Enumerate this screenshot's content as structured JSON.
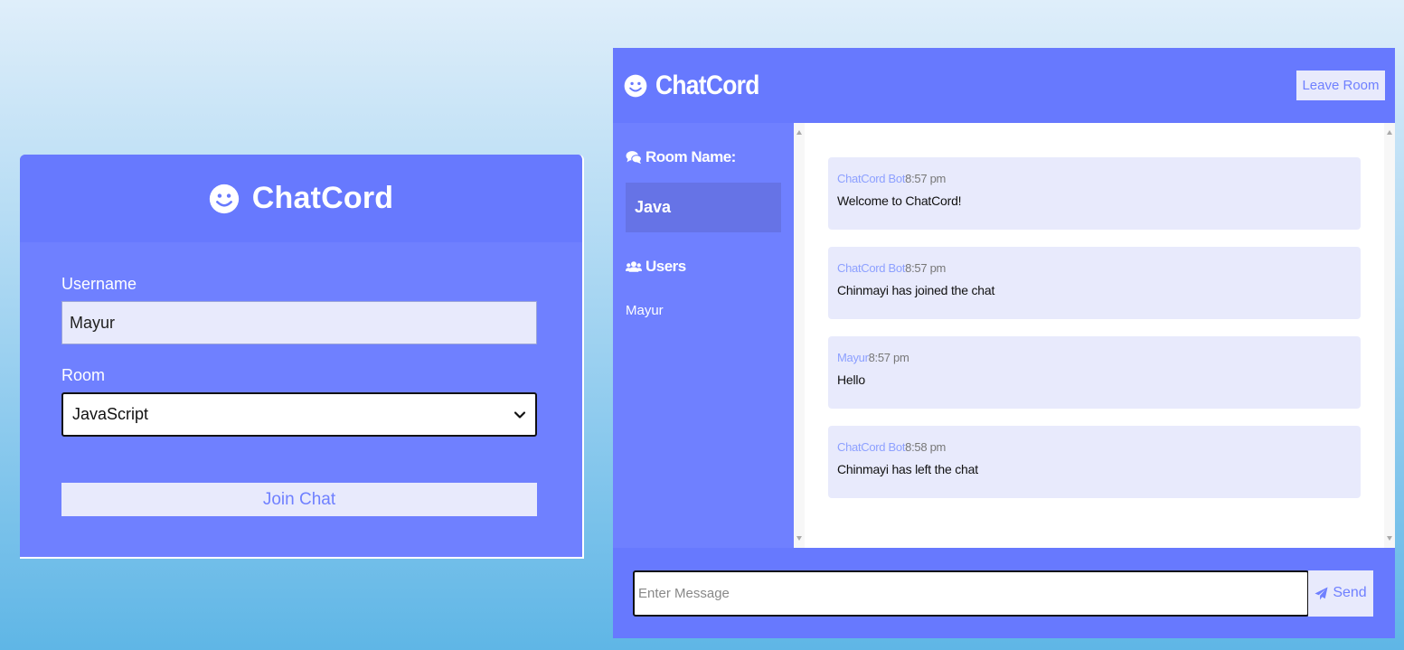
{
  "join": {
    "title": "ChatCord",
    "username_label": "Username",
    "username_value": "Mayur",
    "room_label": "Room",
    "room_selected": "JavaScript",
    "join_button": "Join Chat"
  },
  "chat": {
    "brand": "ChatCord",
    "leave_button": "Leave Room",
    "sidebar": {
      "room_heading": "Room Name:",
      "room_name": "Java",
      "users_heading": "Users",
      "users": [
        "Mayur"
      ]
    },
    "messages": [
      {
        "user": "ChatCord Bot",
        "time": "8:57 pm",
        "text": "Welcome to ChatCord!"
      },
      {
        "user": "ChatCord Bot",
        "time": "8:57 pm",
        "text": "Chinmayi has joined the chat"
      },
      {
        "user": "Mayur",
        "time": "8:57 pm",
        "text": "Hello"
      },
      {
        "user": "ChatCord Bot",
        "time": "8:58 pm",
        "text": "Chinmayi has left the chat"
      }
    ],
    "input_placeholder": "Enter Message",
    "send_button": "Send"
  },
  "icons": {
    "brand": "smile-icon",
    "room": "comments-icon",
    "users": "users-icon",
    "send": "paper-plane-icon",
    "select": "chevron-down-icon"
  },
  "colors": {
    "primary": "#6779fe",
    "secondary": "#6f80ff",
    "light": "#e8eafc",
    "accent_text": "#8da0ff"
  }
}
